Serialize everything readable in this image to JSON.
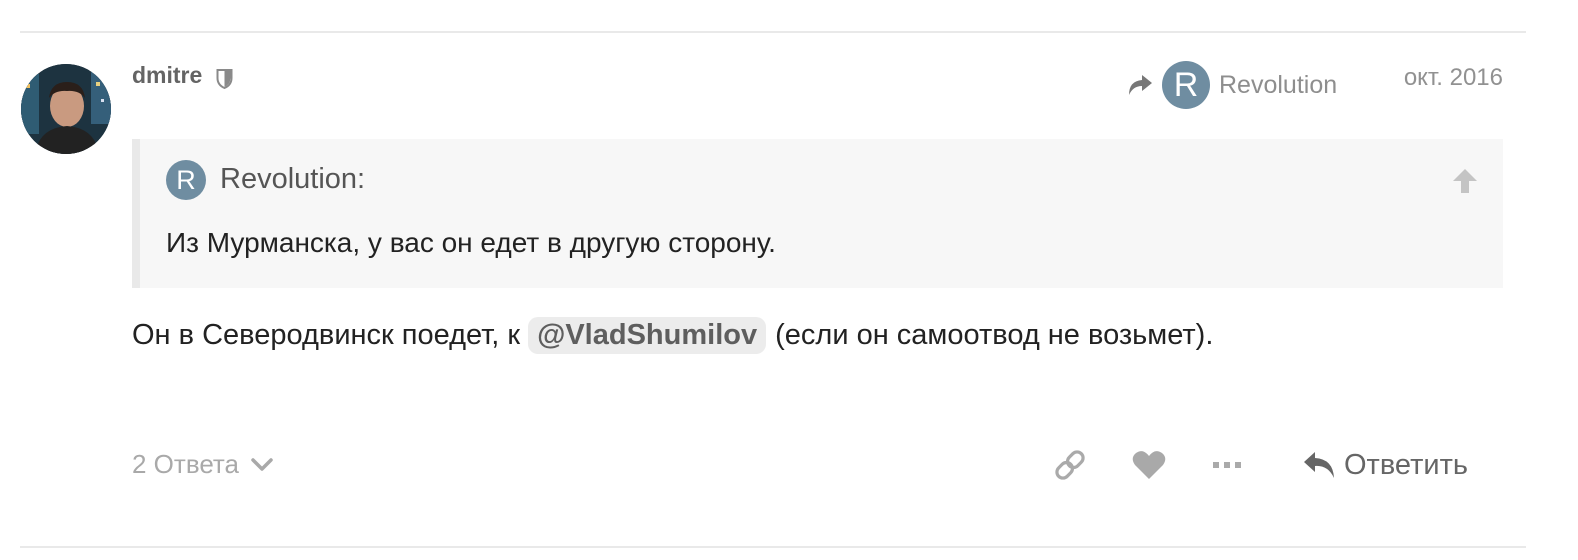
{
  "post": {
    "username": "dmitre",
    "avatar_description": "profile photo of dmitre",
    "reply_to": {
      "avatar_letter": "R",
      "name": "Revolution"
    },
    "date": "окт. 2016",
    "quote": {
      "avatar_letter": "R",
      "author": "Revolution:",
      "text": "Из Мурманска, у вас он едет в другую сторону."
    },
    "body": {
      "before_mention": "Он в Северодвинск поедет, к",
      "mention": "@VladShumilov",
      "after_mention": "(если он самоотвод не возьмет)."
    }
  },
  "footer": {
    "replies_label": "2 Ответа",
    "reply_label": "Ответить"
  },
  "icons": {
    "shield": "shield-icon",
    "share_reply": "reply-arrow-icon",
    "quote_up": "arrow-up-icon",
    "chevron": "chevron-down-icon",
    "link": "link-icon",
    "like": "heart-icon",
    "more": "ellipsis-icon",
    "reply": "reply-icon"
  },
  "colors": {
    "avatar_letter_bg": "#6f8da1",
    "quote_bg": "#f7f7f7",
    "mention_bg": "#ececec",
    "muted_text": "#919191"
  }
}
